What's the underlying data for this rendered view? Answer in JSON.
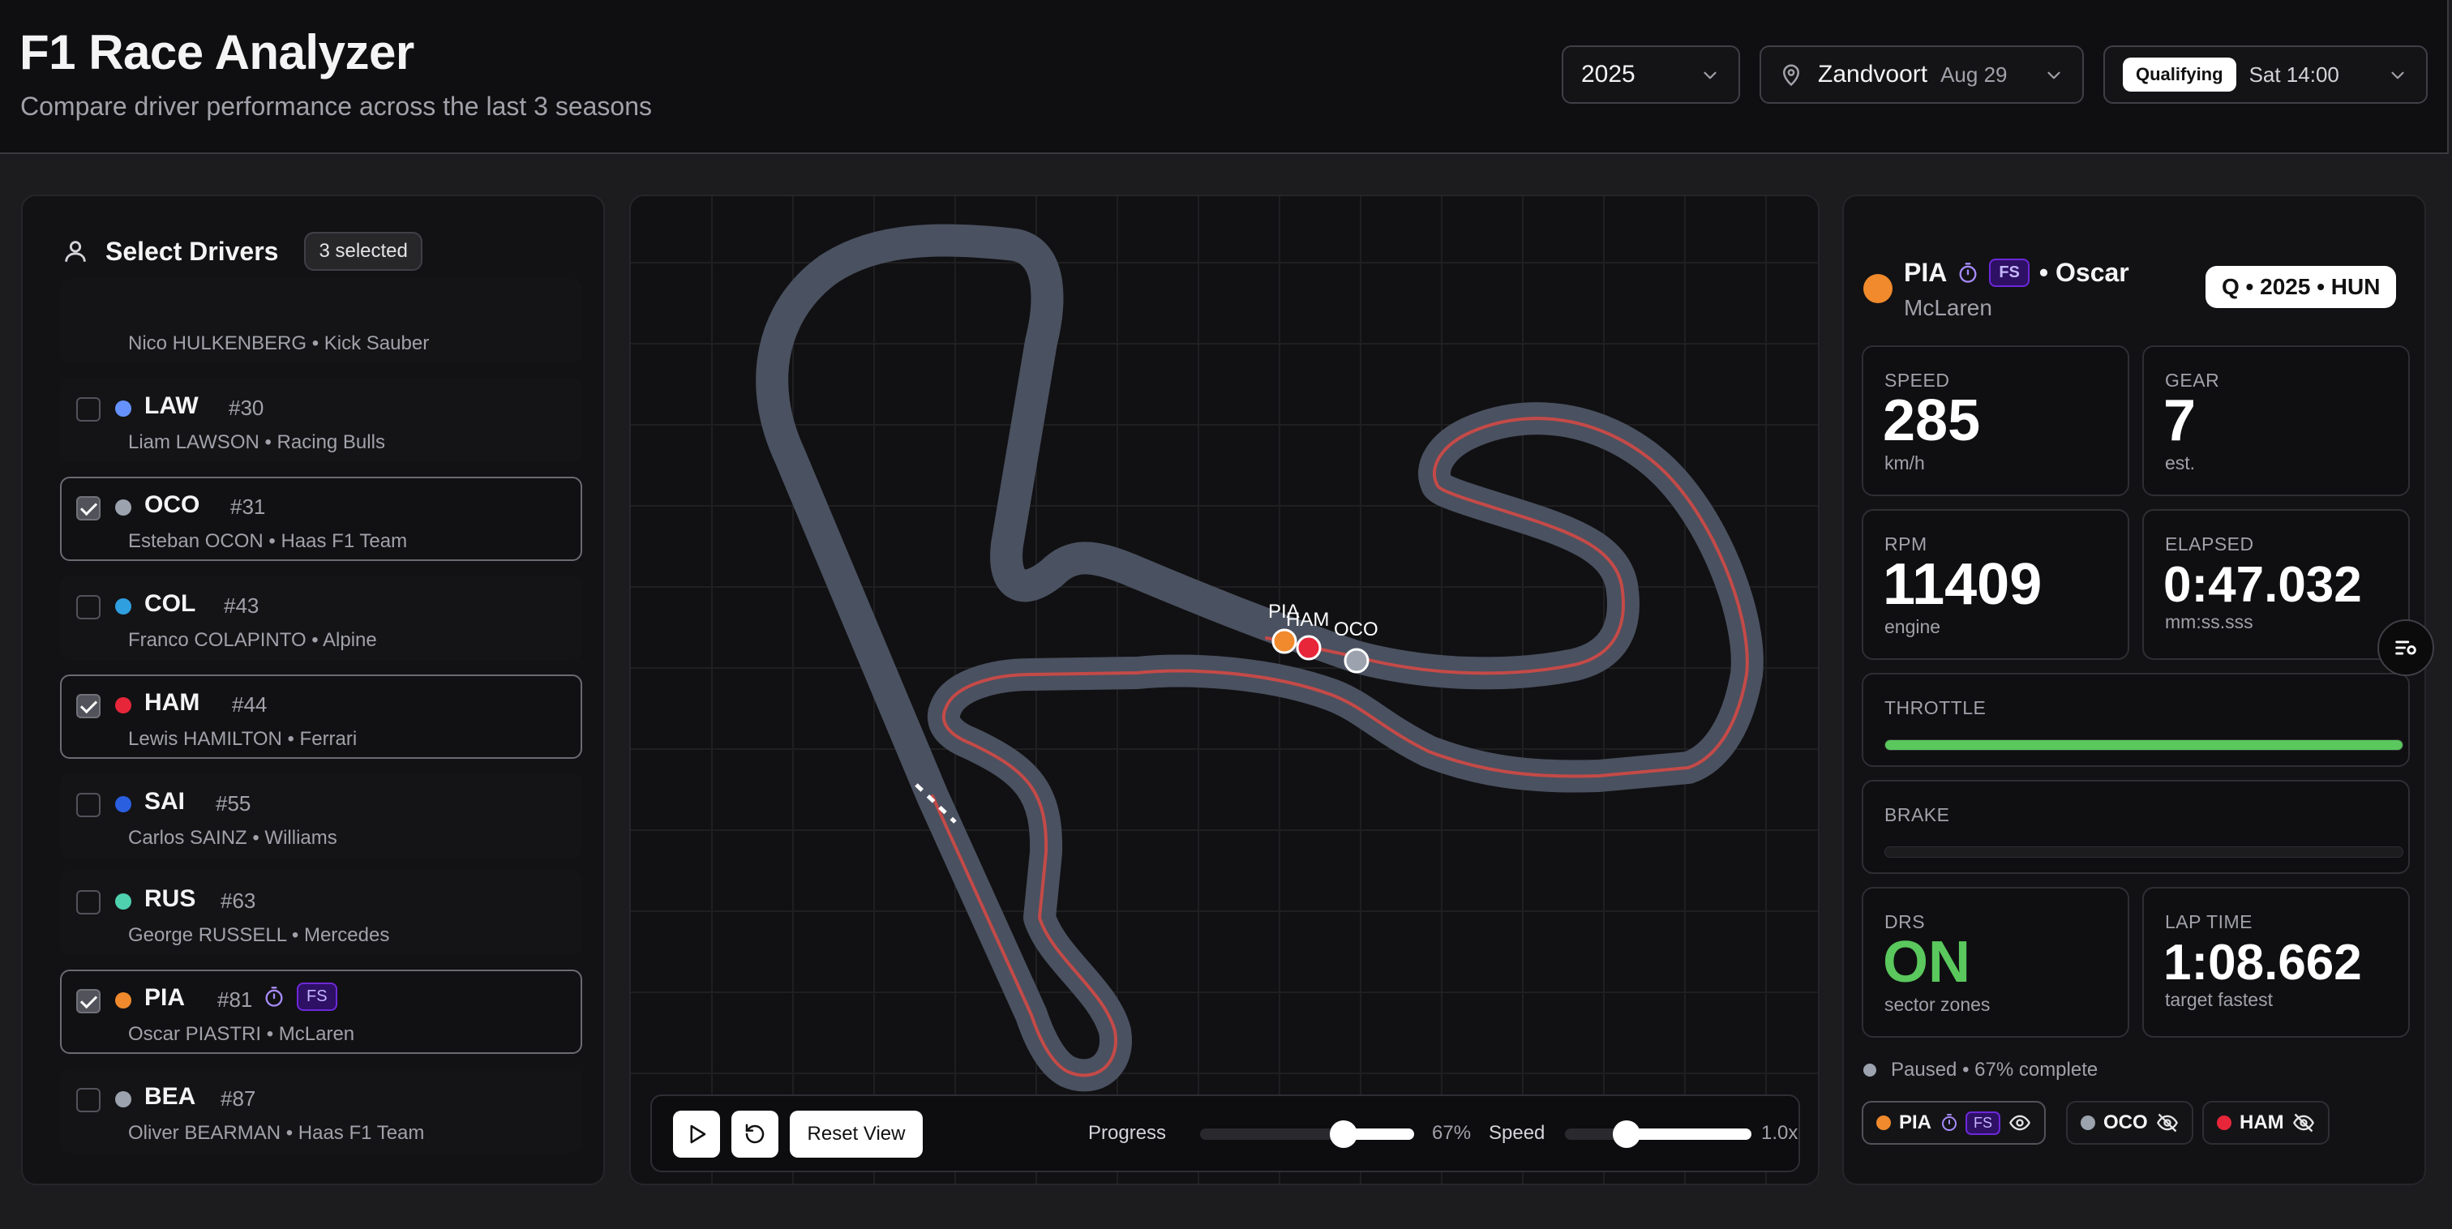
{
  "app": {
    "title": "F1 Race Analyzer",
    "subtitle": "Compare driver performance across the last 3 seasons"
  },
  "header": {
    "year": "2025",
    "track": "Zandvoort",
    "track_date": "Aug 29",
    "session_type": "Qualifying",
    "session_time": "Sat 14:00"
  },
  "drivers_panel": {
    "title": "Select Drivers",
    "selected_count_label": "3 selected",
    "drivers": [
      {
        "code": "",
        "number": "",
        "full": "Nico HULKENBERG • Kick Sauber",
        "color": "#00e701",
        "selected": false
      },
      {
        "code": "LAW",
        "number": "#30",
        "full": "Liam LAWSON • Racing Bulls",
        "color": "#6692ff",
        "selected": false
      },
      {
        "code": "OCO",
        "number": "#31",
        "full": "Esteban OCON • Haas F1 Team",
        "color": "#9ca3af",
        "selected": true
      },
      {
        "code": "COL",
        "number": "#43",
        "full": "Franco COLAPINTO • Alpine",
        "color": "#2f9fe0",
        "selected": false
      },
      {
        "code": "HAM",
        "number": "#44",
        "full": "Lewis HAMILTON • Ferrari",
        "color": "#e8263a",
        "selected": true
      },
      {
        "code": "SAI",
        "number": "#55",
        "full": "Carlos SAINZ • Williams",
        "color": "#2a5fe0",
        "selected": false
      },
      {
        "code": "RUS",
        "number": "#63",
        "full": "George RUSSELL • Mercedes",
        "color": "#4fd1b0",
        "selected": false
      },
      {
        "code": "PIA",
        "number": "#81",
        "full": "Oscar PIASTRI • McLaren",
        "color": "#f08a2c",
        "selected": true,
        "badge": "FS"
      },
      {
        "code": "BEA",
        "number": "#87",
        "full": "Oliver BEARMAN • Haas F1 Team",
        "color": "#9ca3af",
        "selected": false
      }
    ]
  },
  "map": {
    "markers": [
      {
        "code": "PIA",
        "color": "#f08a2c"
      },
      {
        "code": "HAM",
        "color": "#e8263a"
      },
      {
        "code": "OCO",
        "color": "#9ca3af"
      }
    ],
    "controls": {
      "reset_label": "Reset View",
      "progress_label": "Progress",
      "progress_value": "67%",
      "progress_fraction": 0.67,
      "speed_label": "Speed",
      "speed_value": "1.0x",
      "speed_fraction": 0.33
    }
  },
  "telemetry": {
    "driver_code": "PIA",
    "driver_badge": "FS",
    "driver_first": "• Oscar",
    "team": "McLaren",
    "driver_color": "#f08a2c",
    "session_tag": "Q • 2025 • HUN",
    "speed": {
      "label": "SPEED",
      "value": "285",
      "unit": "km/h"
    },
    "gear": {
      "label": "GEAR",
      "value": "7",
      "unit": "est."
    },
    "rpm": {
      "label": "RPM",
      "value": "11409",
      "unit": "engine"
    },
    "elapsed": {
      "label": "ELAPSED",
      "value": "0:47.032",
      "unit": "mm:ss.sss"
    },
    "throttle": {
      "label": "THROTTLE",
      "fraction": 1.0,
      "color": "#5ac85d"
    },
    "brake": {
      "label": "BRAKE",
      "fraction": 0.0
    },
    "drs": {
      "label": "DRS",
      "value": "ON",
      "unit": "sector zones",
      "color": "#5ac85d"
    },
    "lap_time": {
      "label": "LAP TIME",
      "value": "1:08.662",
      "unit": "target fastest"
    },
    "status": "Paused • 67% complete",
    "chips": [
      {
        "code": "PIA",
        "color": "#f08a2c",
        "badge": "FS",
        "visible": true
      },
      {
        "code": "OCO",
        "color": "#9ca3af",
        "visible": false
      },
      {
        "code": "HAM",
        "color": "#e8263a",
        "visible": false
      }
    ]
  }
}
